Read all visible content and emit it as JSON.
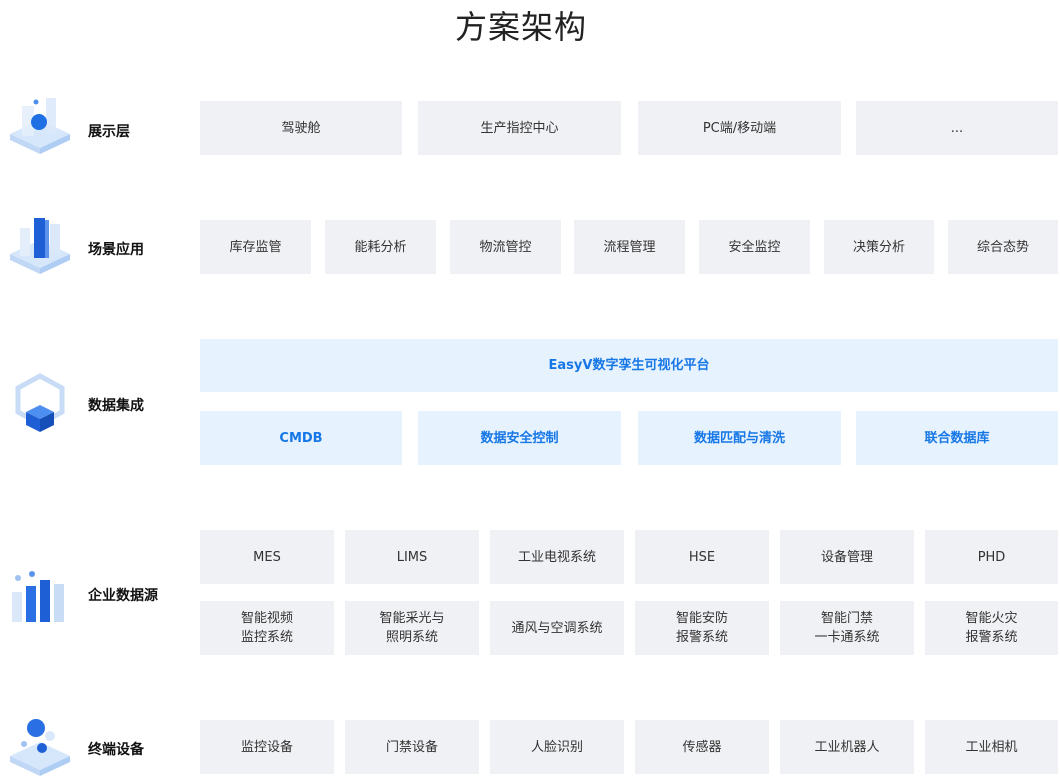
{
  "title": "方案架构",
  "layers": {
    "presentation": {
      "label": "展示层",
      "items": [
        "驾驶舱",
        "生产指控中心",
        "PC端/移动端",
        "..."
      ]
    },
    "scenarios": {
      "label": "场景应用",
      "items": [
        "库存监管",
        "能耗分析",
        "物流管控",
        "流程管理",
        "安全监控",
        "决策分析",
        "综合态势"
      ]
    },
    "integration": {
      "label": "数据集成",
      "platform": "EasyV数字孪生可视化平台",
      "items": [
        "CMDB",
        "数据安全控制",
        "数据匹配与清洗",
        "联合数据库"
      ]
    },
    "sources": {
      "label": "企业数据源",
      "row1": [
        "MES",
        "LIMS",
        "工业电视系统",
        "HSE",
        "设备管理",
        "PHD"
      ],
      "row2": [
        "智能视频\n监控系统",
        "智能采光与\n照明系统",
        "通风与空调系统",
        "智能安防\n报警系统",
        "智能门禁\n一卡通系统",
        "智能火灾\n报警系统"
      ]
    },
    "devices": {
      "label": "终端设备",
      "items": [
        "监控设备",
        "门禁设备",
        "人脸识别",
        "传感器",
        "工业机器人",
        "工业相机"
      ]
    }
  },
  "colors": {
    "box_gray": "#f0f1f4",
    "box_blue": "#e6f2fd",
    "accent_blue": "#1677e6"
  },
  "icons": {
    "presentation": "blue-sphere-cube-icon",
    "scenarios": "blue-pillar-cube-icon",
    "integration": "cube-frame-icon",
    "sources": "bar-columns-icon",
    "devices": "stacked-spheres-platform-icon"
  }
}
